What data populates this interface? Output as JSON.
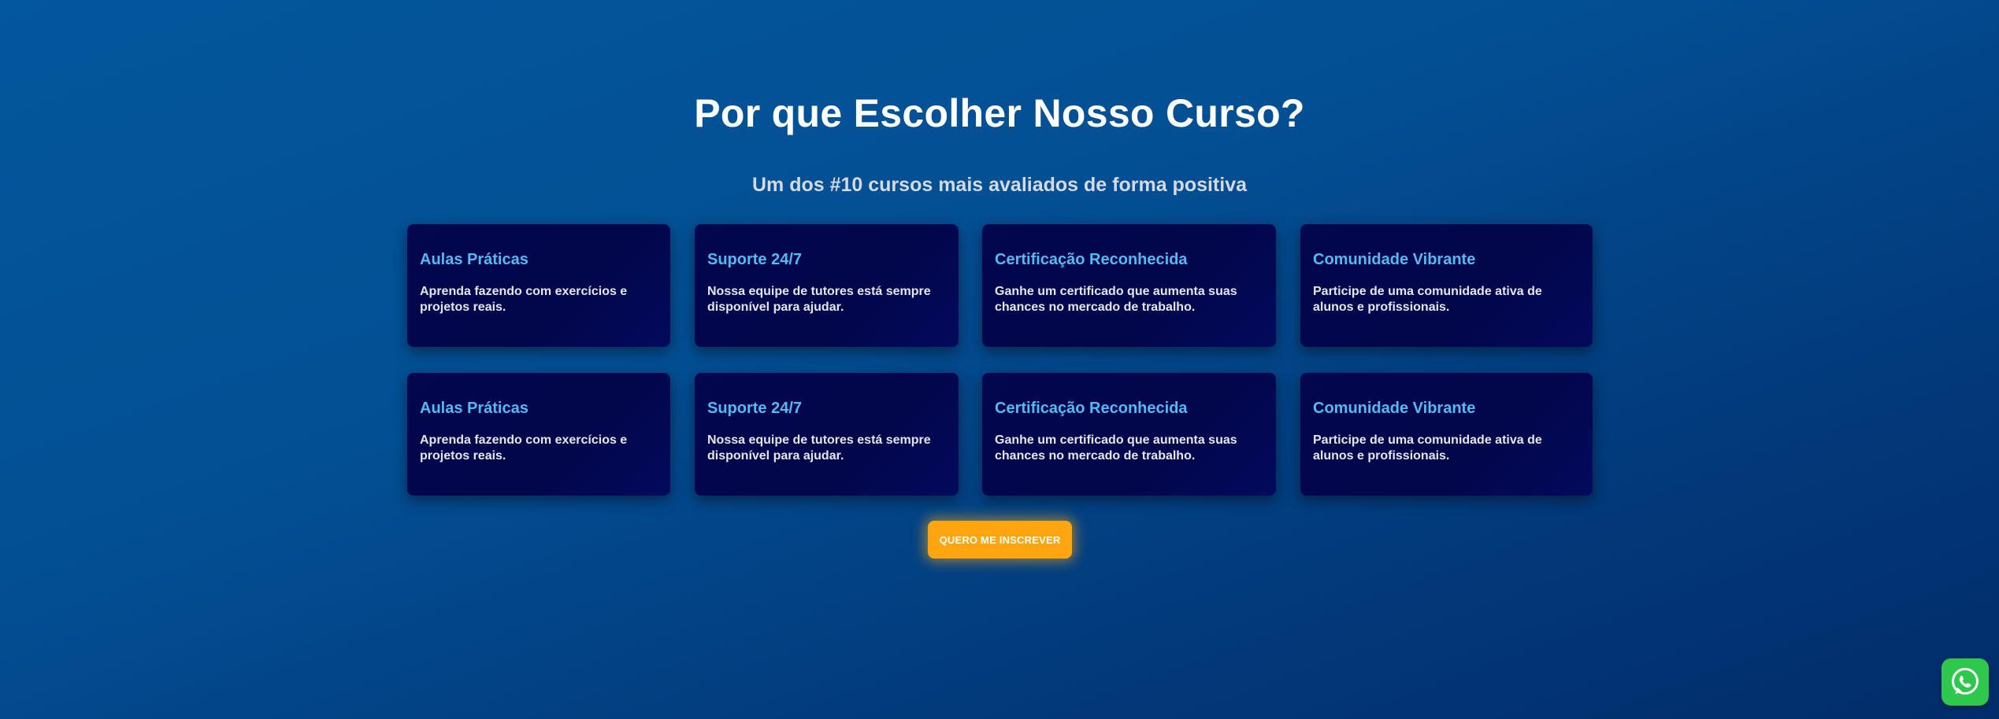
{
  "section": {
    "title": "Por que Escolher Nosso Curso?",
    "subtitle": "Um dos #10 cursos mais avaliados de forma positiva"
  },
  "features": [
    {
      "title": "Aulas Práticas",
      "text": "Aprenda fazendo com exercícios e projetos reais."
    },
    {
      "title": "Suporte 24/7",
      "text": "Nossa equipe de tutores está sempre disponível para ajudar."
    },
    {
      "title": "Certificação Reconhecida",
      "text": "Ganhe um certificado que aumenta suas chances no mercado de trabalho."
    },
    {
      "title": "Comunidade Vibrante",
      "text": "Participe de uma comunidade ativa de alunos e profissionais."
    },
    {
      "title": "Aulas Práticas",
      "text": "Aprenda fazendo com exercícios e projetos reais."
    },
    {
      "title": "Suporte 24/7",
      "text": "Nossa equipe de tutores está sempre disponível para ajudar."
    },
    {
      "title": "Certificação Reconhecida",
      "text": "Ganhe um certificado que aumenta suas chances no mercado de trabalho."
    },
    {
      "title": "Comunidade Vibrante",
      "text": "Participe de uma comunidade ativa de alunos e profissionais."
    }
  ],
  "cta": {
    "label": "QUERO ME INSCREVER"
  },
  "whatsapp": {
    "icon": "whatsapp-icon"
  },
  "colors": {
    "background_top": "#03579c",
    "background_bottom": "#022c6a",
    "card_background": "#02074e",
    "card_title": "#53baf3",
    "cta_background": "#ffa510",
    "whatsapp_green": "#2ec94c"
  }
}
